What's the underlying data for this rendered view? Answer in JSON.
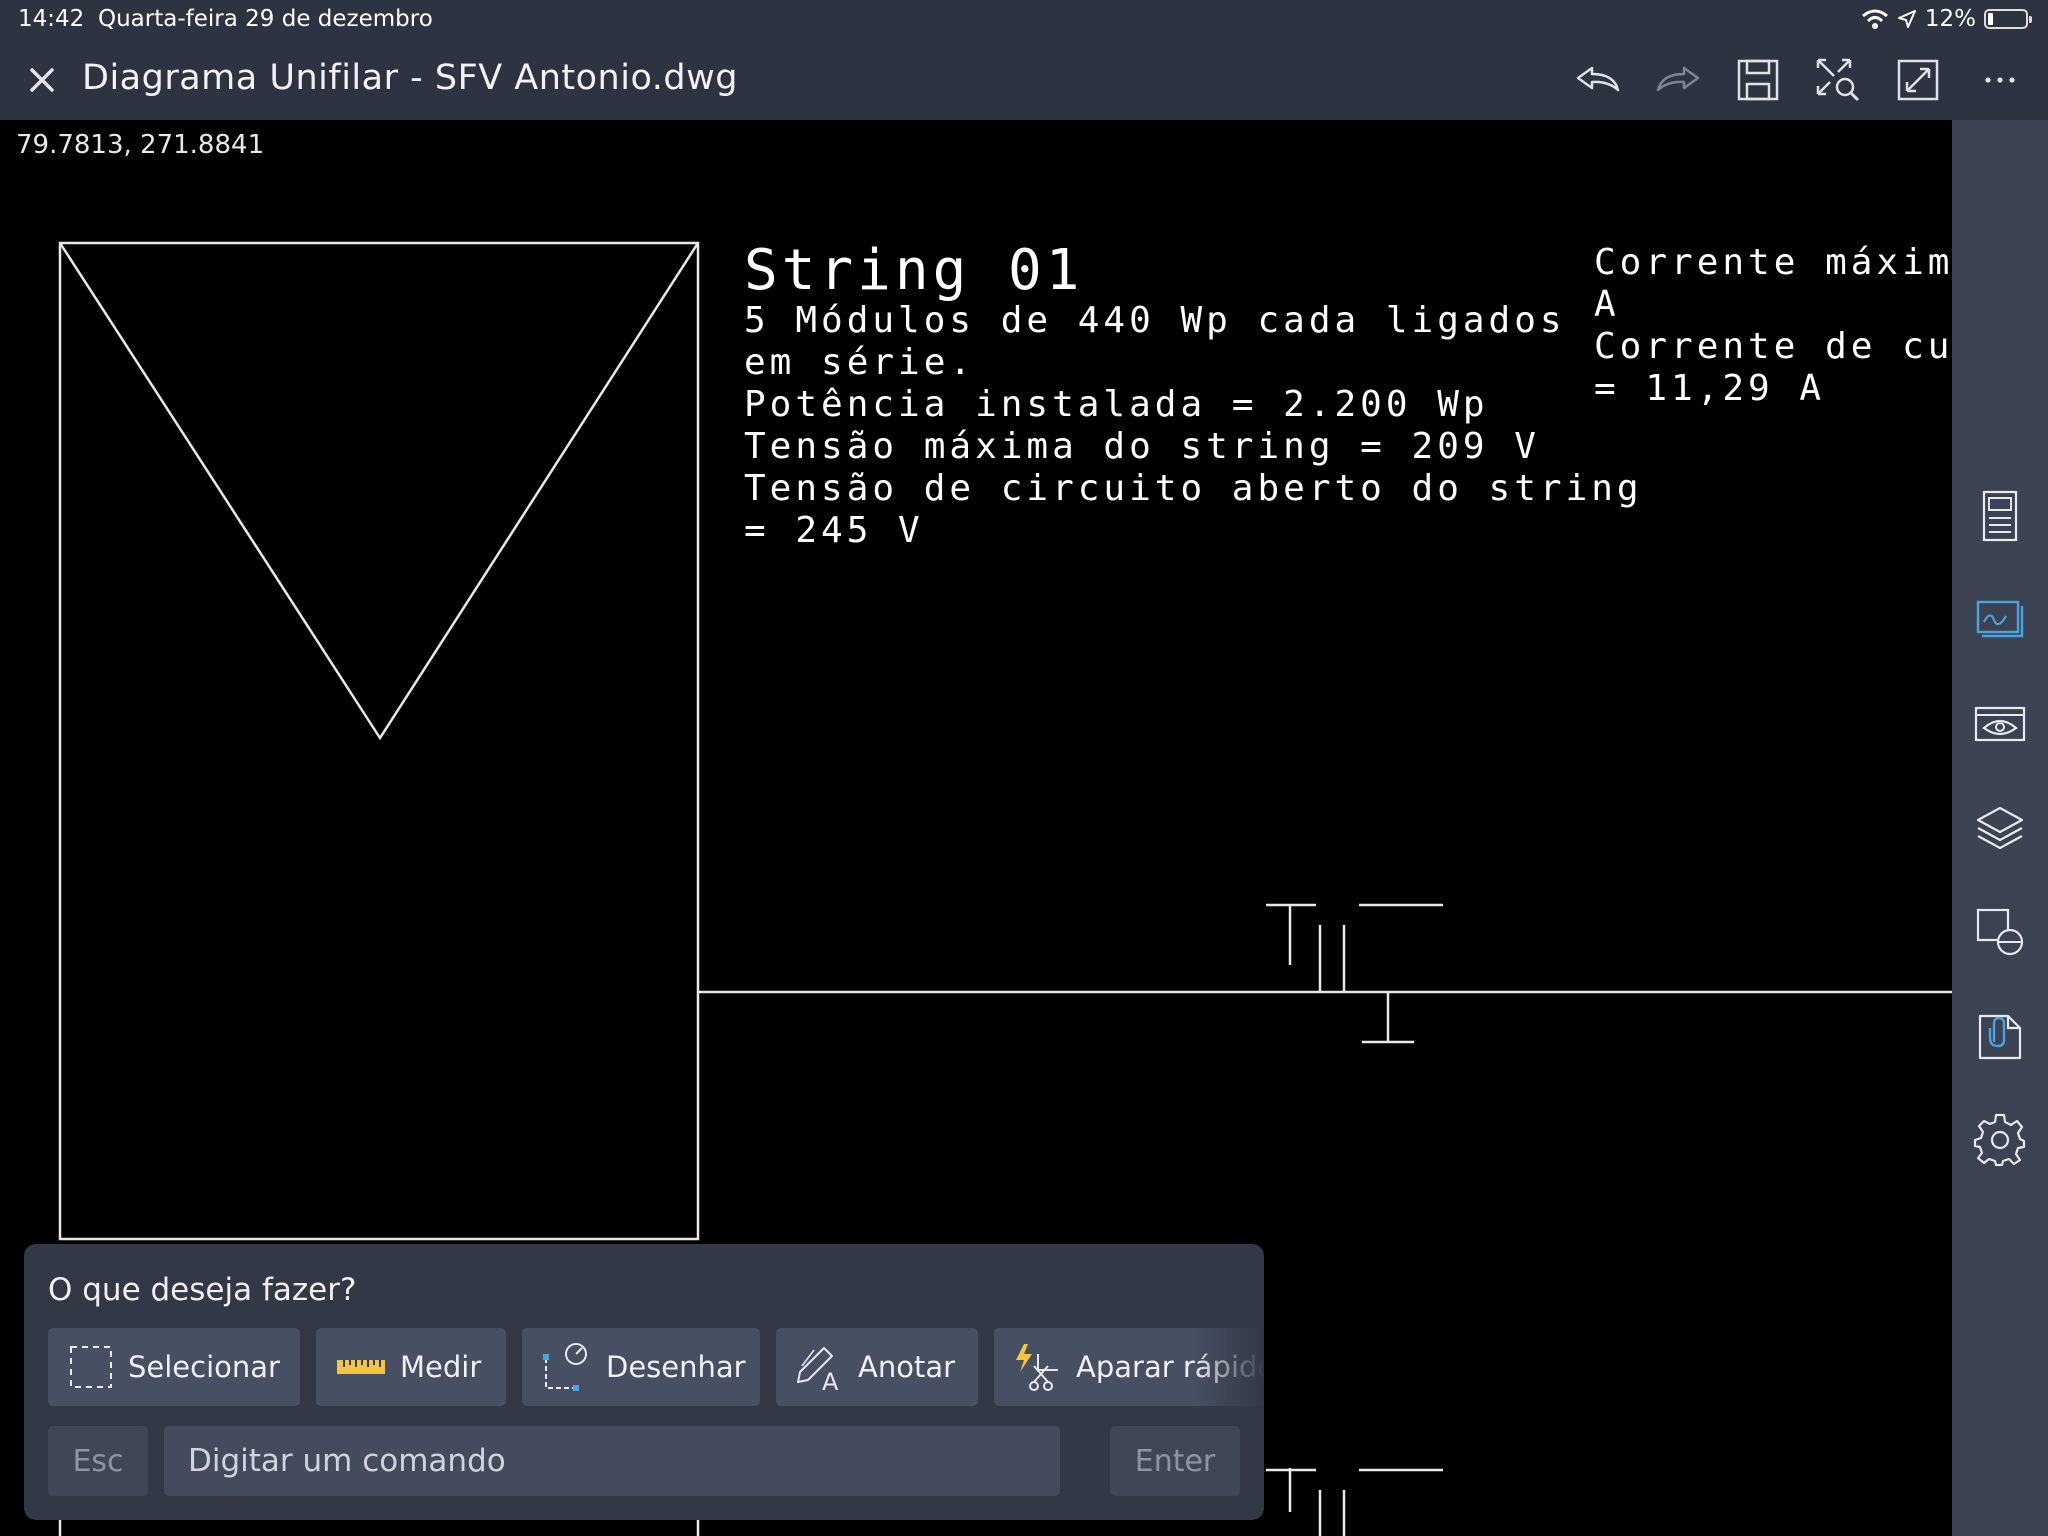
{
  "status_bar": {
    "time": "14:42",
    "date": "Quarta-feira 29 de dezembro",
    "battery": "12%",
    "icons": [
      "wifi-icon",
      "location-icon",
      "battery-icon"
    ]
  },
  "title_bar": {
    "title": "Diagrama Unifilar - SFV Antonio.dwg",
    "actions": [
      "close-icon",
      "undo-icon",
      "redo-icon",
      "save-icon",
      "zoom-extents-icon",
      "fullscreen-icon",
      "more-icon"
    ]
  },
  "canvas": {
    "coordinates": "79.7813,  271.8841",
    "string_title": "String  01",
    "string_lines": [
      "5  Módulos  de  440  Wp  cada  ligados",
      "em  série.",
      "Potência  instalada  =  2.200  Wp",
      "Tensão  máxima  do  string  =  209  V",
      "Tensão  de  circuito  aberto  do  string",
      "=  245  V"
    ],
    "current_lines": [
      "Corrente  máxima",
      "A",
      "Corrente  de  curto",
      "=  11,29  A"
    ]
  },
  "right_toolbar": [
    "properties-icon",
    "layouts-icon",
    "view-icon",
    "layers-icon",
    "blocks-icon",
    "attachments-icon",
    "settings-icon"
  ],
  "command_panel": {
    "prompt": "O que deseja fazer?",
    "tools": [
      {
        "label": "Selecionar",
        "icon": "select-icon"
      },
      {
        "label": "Medir",
        "icon": "ruler-icon"
      },
      {
        "label": "Desenhar",
        "icon": "draw-icon"
      },
      {
        "label": "Anotar",
        "icon": "annotate-icon"
      },
      {
        "label": "Aparar rápido",
        "icon": "quick-trim-icon"
      }
    ],
    "esc_label": "Esc",
    "input_placeholder": "Digitar um comando",
    "enter_label": "Enter"
  },
  "colors": {
    "chrome": "#2d3340",
    "canvas": "#000000",
    "side_toolbar": "#3b4252",
    "panel": "#323846",
    "accent_yellow": "#f5c542",
    "accent_blue": "#4aa3df"
  }
}
